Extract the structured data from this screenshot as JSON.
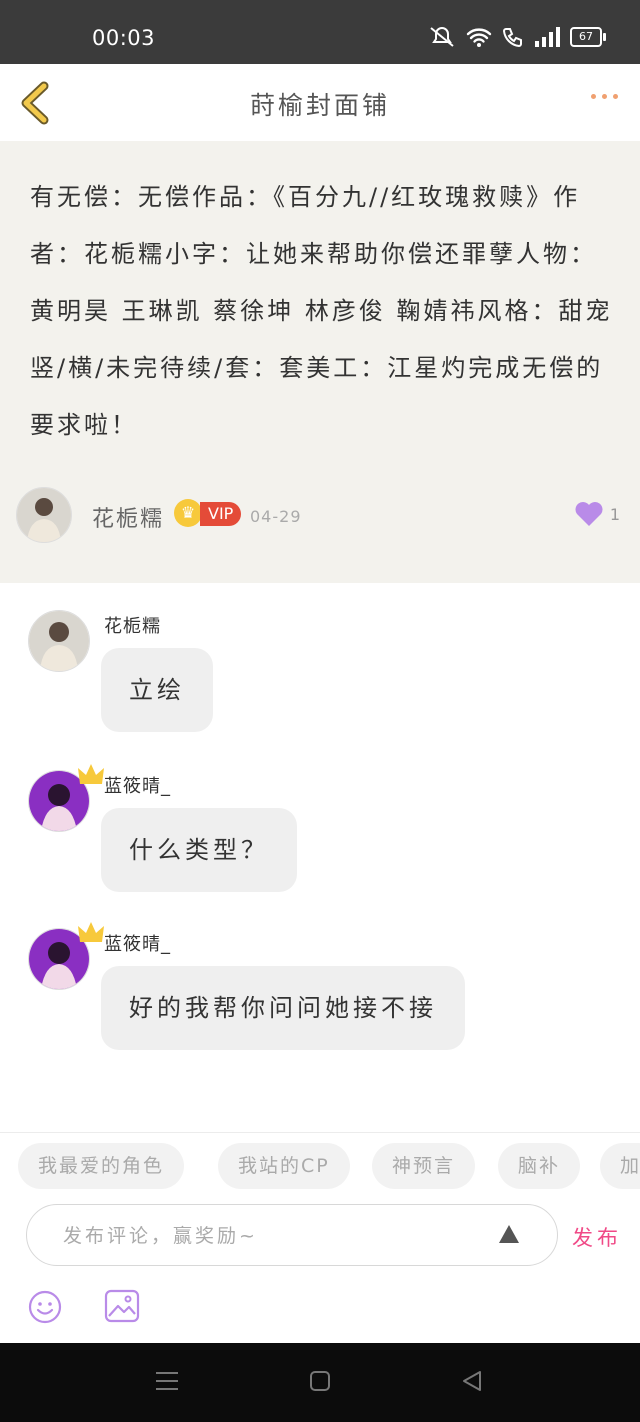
{
  "status_bar": {
    "time": "00:03",
    "battery": "67",
    "icons": [
      "mute-icon",
      "wifi-icon",
      "call-icon",
      "signal-icon",
      "battery-icon"
    ]
  },
  "header": {
    "title": "莳榆封面铺",
    "back_icon": "chevron-left-icon",
    "more_icon": "more-dots-icon",
    "accent_color": "#f2c94c"
  },
  "post": {
    "content": "有无偿：无偿作品：《百分九//红玫瑰救赎》作者：花栀糯小字：让她来帮助你偿还罪孽人物：黄明昊 王琳凯 蔡徐坤 林彦俊 鞠婧祎风格：甜宠竖/横/未完待续/套：套美工：江星灼完成无偿的要求啦！",
    "author": "花栀糯",
    "vip_label": "VIP",
    "date": "04-29",
    "likes": "1",
    "like_color": "#b98be8"
  },
  "comments": [
    {
      "name": "花栀糯",
      "text": "立绘",
      "crowned": false
    },
    {
      "name": "蓝筱晴_",
      "text": "什么类型？",
      "crowned": true
    },
    {
      "name": "蓝筱晴_",
      "text": "好的我帮你问问她接不接",
      "crowned": true
    }
  ],
  "tags": [
    "我最爱的角色",
    "我站的CP",
    "神预言",
    "脑补",
    "加"
  ],
  "composer": {
    "placeholder": "发布评论，赢奖励~",
    "publish_label": "发布",
    "publish_color": "#f04a87"
  }
}
